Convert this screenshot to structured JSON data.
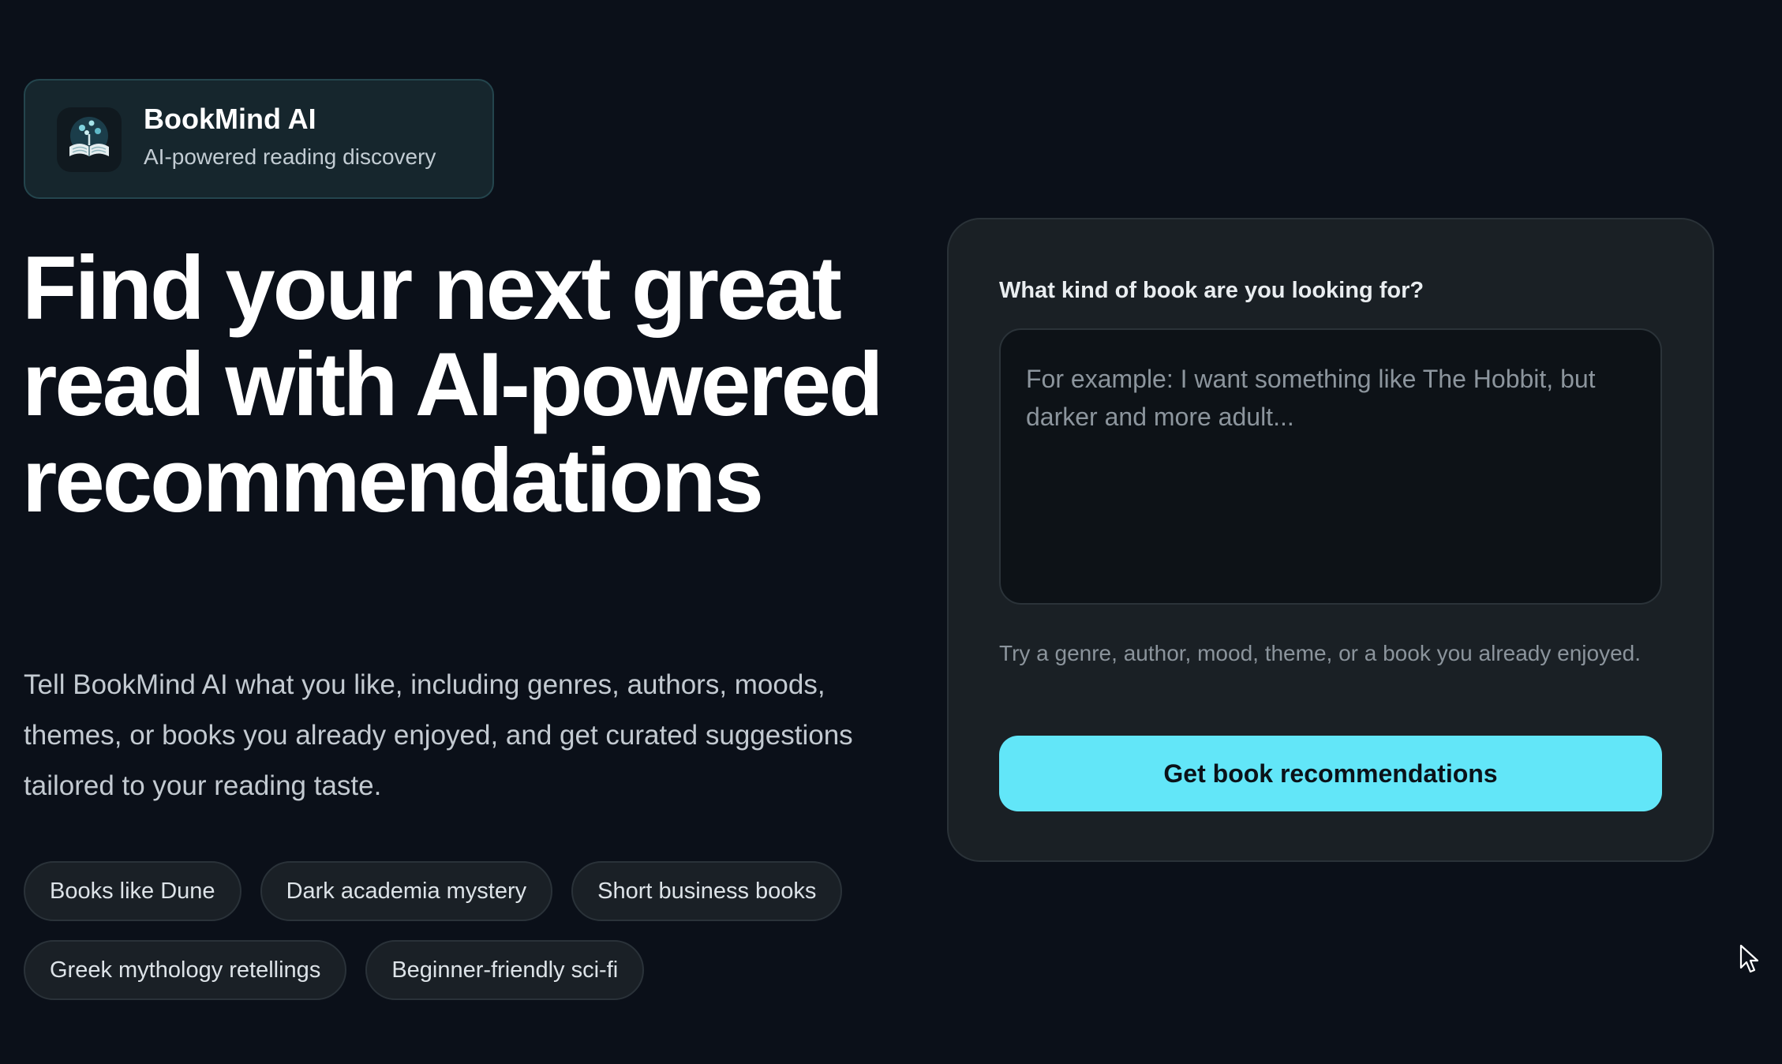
{
  "brand": {
    "name": "BookMind AI",
    "tagline": "AI-powered reading discovery",
    "logo_icon": "open-book-tree-icon"
  },
  "hero": {
    "title": "Find your next great read with AI-powered recommendations",
    "description": "Tell BookMind AI what you like, including genres, authors, moods, themes, or books you already enjoyed, and get curated suggestions tailored to your reading taste."
  },
  "suggestions": [
    "Books like Dune",
    "Dark academia mystery",
    "Short business books",
    "Greek mythology retellings",
    "Beginner-friendly sci-fi"
  ],
  "form": {
    "label": "What kind of book are you looking for?",
    "input_value": "",
    "input_placeholder": "For example: I want something like The Hobbit, but darker and more adult...",
    "hint": "Try a genre, author, mood, theme, or a book you already enjoyed.",
    "submit_label": "Get book recommendations"
  },
  "colors": {
    "background": "#0b1019",
    "accent": "#62e6f8",
    "brand_card": "#16262d",
    "panel": "#1a2025"
  }
}
